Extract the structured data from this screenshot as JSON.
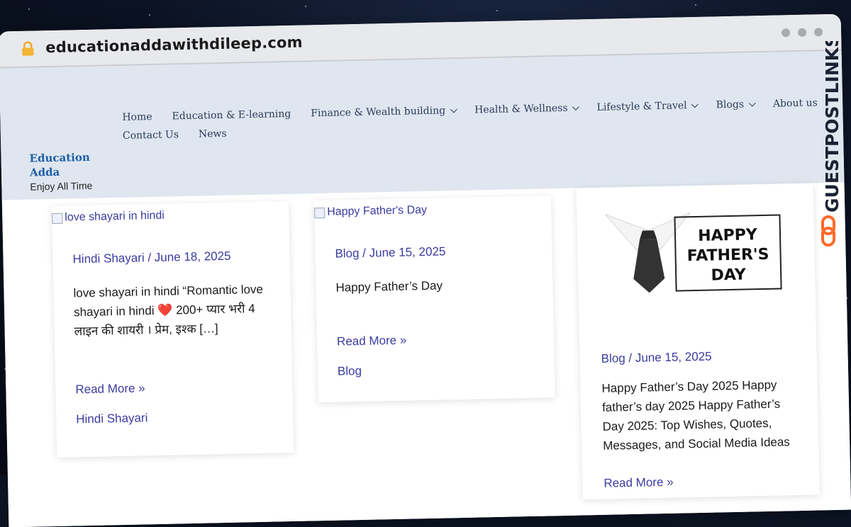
{
  "browser": {
    "url": "educationaddawithdileep.com"
  },
  "site": {
    "logo_title": "Education Adda",
    "tagline": "Enjoy All Time"
  },
  "nav": {
    "row1": [
      {
        "label": "Home",
        "has_dropdown": false
      },
      {
        "label": "Education & E-learning",
        "has_dropdown": false
      },
      {
        "label": "Finance & Wealth building",
        "has_dropdown": true
      },
      {
        "label": "Health & Wellness",
        "has_dropdown": true
      },
      {
        "label": "Lifestyle & Travel",
        "has_dropdown": true
      },
      {
        "label": "Blogs",
        "has_dropdown": true
      },
      {
        "label": "About us",
        "has_dropdown": false
      }
    ],
    "row2": [
      {
        "label": "Contact Us",
        "has_dropdown": false
      },
      {
        "label": "News",
        "has_dropdown": false
      }
    ]
  },
  "posts": [
    {
      "image_alt": "love shayari in hindi",
      "meta": "Hindi Shayari / June 18, 2025",
      "excerpt": "love shayari in hindi “Romantic love shayari in hindi ❤️ 200+ प्यार भरी 4 लाइन की शायरी । प्रेम, इश्क […]",
      "read_more": "Read More »",
      "category": "Hindi Shayari"
    },
    {
      "image_alt": "Happy Father's Day",
      "meta": "Blog / June 15, 2025",
      "excerpt": "Happy Father’s Day",
      "read_more": "Read More »",
      "category": "Blog"
    },
    {
      "image_text": "HAPPY FATHER'S DAY",
      "meta": "Blog / June 15, 2025",
      "excerpt": "Happy Father’s Day 2025 Happy father’s day 2025 Happy Father’s Day 2025: Top Wishes, Quotes, Messages, and Social Media Ideas",
      "read_more": "Read More »"
    }
  ],
  "watermark": {
    "text": "GUESTPOSTLINKS"
  },
  "colors": {
    "header_bg": "#dfe6ef",
    "logo_blue": "#1f5fa8",
    "link_purple": "#3b3ba0",
    "watermark_dark": "#1b2233",
    "watermark_orange": "#ff6a2a"
  }
}
